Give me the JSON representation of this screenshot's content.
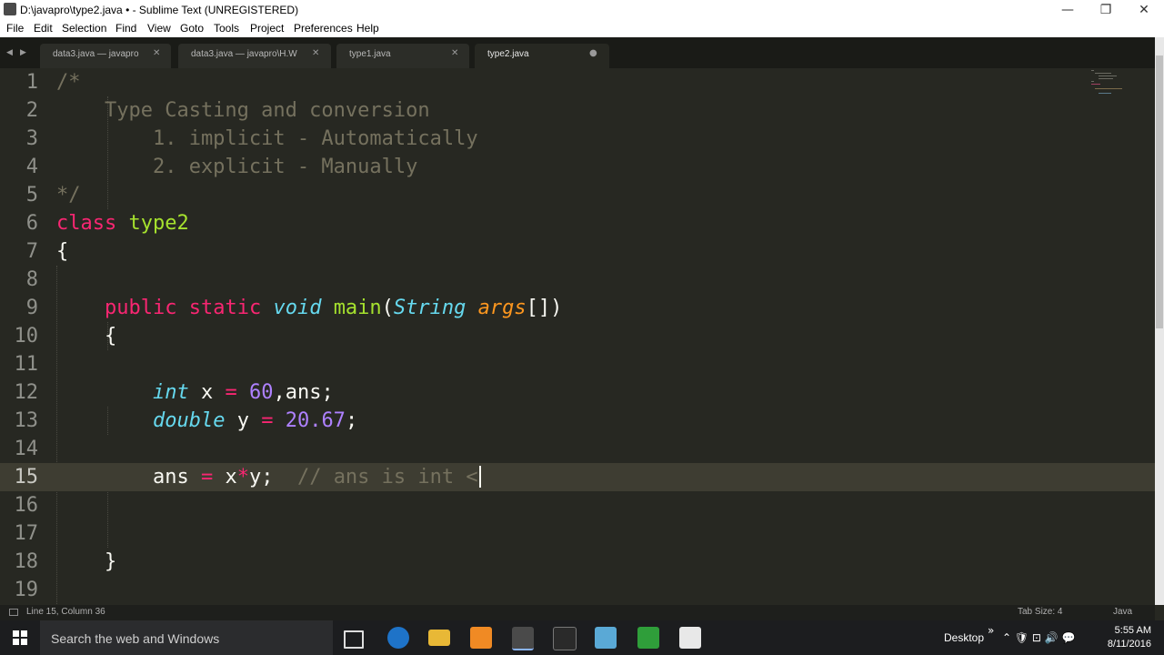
{
  "window": {
    "title": "D:\\javapro\\type2.java • - Sublime Text (UNREGISTERED)",
    "minimize_glyph": "—",
    "restore_glyph": "❐",
    "close_glyph": "✕"
  },
  "menu": [
    "File",
    "Edit",
    "Selection",
    "Find",
    "View",
    "Goto",
    "Tools",
    "Project",
    "Preferences",
    "Help"
  ],
  "tabs": [
    {
      "label": "data3.java — javapro",
      "close": "✕",
      "active": false
    },
    {
      "label": "data3.java — javapro\\H.W",
      "close": "✕",
      "active": false
    },
    {
      "label": "type1.java",
      "close": "✕",
      "active": false
    },
    {
      "label": "type2.java",
      "close": "●",
      "active": true
    }
  ],
  "tab_nav": {
    "left": "◀",
    "right": "▶"
  },
  "editor": {
    "line_numbers": [
      "1",
      "2",
      "3",
      "4",
      "5",
      "6",
      "7",
      "8",
      "9",
      "10",
      "11",
      "12",
      "13",
      "14",
      "15",
      "16",
      "17",
      "18",
      "19"
    ],
    "current_line": 15,
    "code": {
      "l1": "/*",
      "l2": "    Type Casting and conversion",
      "l3": "        1. implicit - Automatically",
      "l4": "        2. explicit - Manually",
      "l5": "*/",
      "l6_kw": "class",
      "l6_name": "type2",
      "l7": "{",
      "l9_kw1": "public",
      "l9_kw2": "static",
      "l9_void": "void",
      "l9_fn": "main",
      "l9_paren": "(",
      "l9_type": "String",
      "l9_arg": "args",
      "l9_end": "[])",
      "l10": "{",
      "l12_type": "int",
      "l12_a": " x ",
      "l12_eq": "=",
      "l12_num": "60",
      "l12_b": ",ans;",
      "l13_type": "double",
      "l13_a": " y ",
      "l13_eq": "=",
      "l13_num": "20.67",
      "l13_b": ";",
      "l15_a": "ans ",
      "l15_eq": "=",
      "l15_b": " x",
      "l15_op": "*",
      "l15_c": "y;",
      "l15_comment": "// ans is int <",
      "l18": "}"
    }
  },
  "status": {
    "position": "Line 15, Column 36",
    "tab_size": "Tab Size: 4",
    "syntax": "Java"
  },
  "taskbar": {
    "search_placeholder": "Search the web and Windows",
    "desktop_label": "Desktop",
    "tray_chevron": "»",
    "tray_icons": "⌃ 🛡 ⊡ 🔊 💬",
    "time": "5:55 AM",
    "date": "8/11/2016"
  },
  "colors": {
    "editor_bg": "#272822",
    "comment": "#75715e",
    "keyword": "#f92672",
    "class_name": "#a6e22e",
    "type": "#66d9ef",
    "argument": "#fd971f",
    "number": "#ae81ff",
    "current_line": "#3e3d32"
  }
}
